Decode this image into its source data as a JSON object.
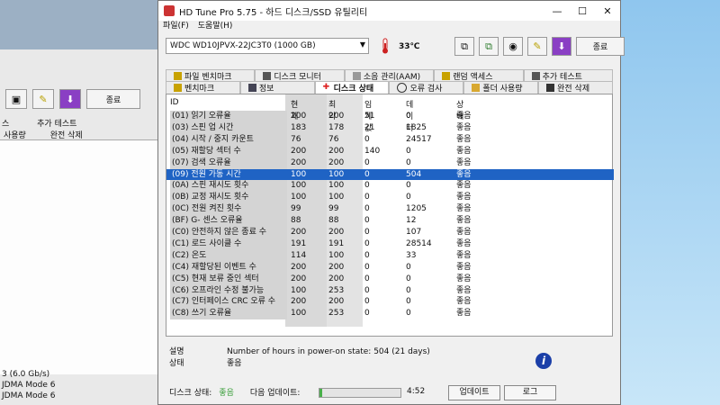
{
  "window": {
    "title": "HD Tune Pro 5.75 - 하드 디스크/SSD 유틸리티",
    "minimize": "—",
    "maximize": "☐",
    "close": "✕"
  },
  "menu": [
    "파일(F)",
    "도움말(H)"
  ],
  "toolbar": {
    "drive": "WDC WD10JPVX-22JC3T0 (1000 GB)",
    "temperature": "33℃",
    "exit_label": "종료"
  },
  "tabs_row1": [
    "파일 벤치마크",
    "디스크 모니터",
    "소음 관리(AAM)",
    "랜덤 액세스",
    "추가 테스트"
  ],
  "tabs_row2": [
    "벤치마크",
    "정보",
    "디스크 상태",
    "오류 검사",
    "폴더 사용량",
    "완전 삭제"
  ],
  "columns": [
    "ID",
    "현재",
    "최악",
    "임계값",
    "데이터",
    "상태"
  ],
  "rows": [
    {
      "id": "(01) 읽기 오류율",
      "cur": "200",
      "wor": "200",
      "thr": "51",
      "dat": "0",
      "st": "좋음"
    },
    {
      "id": "(03) 스핀 업 시간",
      "cur": "183",
      "wor": "178",
      "thr": "21",
      "dat": "1825",
      "st": "좋음"
    },
    {
      "id": "(04) 시작 / 중지 카운트",
      "cur": "76",
      "wor": "76",
      "thr": "0",
      "dat": "24517",
      "st": "좋음"
    },
    {
      "id": "(05) 재할당 섹터 수",
      "cur": "200",
      "wor": "200",
      "thr": "140",
      "dat": "0",
      "st": "좋음"
    },
    {
      "id": "(07) 검색 오류율",
      "cur": "200",
      "wor": "200",
      "thr": "0",
      "dat": "0",
      "st": "좋음"
    },
    {
      "id": "(09) 전원 가동 시간",
      "cur": "100",
      "wor": "100",
      "thr": "0",
      "dat": "504",
      "st": "좋음"
    },
    {
      "id": "(0A) 스핀 재시도 횟수",
      "cur": "100",
      "wor": "100",
      "thr": "0",
      "dat": "0",
      "st": "좋음"
    },
    {
      "id": "(0B) 교정 재시도 횟수",
      "cur": "100",
      "wor": "100",
      "thr": "0",
      "dat": "0",
      "st": "좋음"
    },
    {
      "id": "(0C) 전원 켜진 횟수",
      "cur": "99",
      "wor": "99",
      "thr": "0",
      "dat": "1205",
      "st": "좋음"
    },
    {
      "id": "(BF) G- 센스 오류율",
      "cur": "88",
      "wor": "88",
      "thr": "0",
      "dat": "12",
      "st": "좋음"
    },
    {
      "id": "(C0) 안전하지 않은 종료 수",
      "cur": "200",
      "wor": "200",
      "thr": "0",
      "dat": "107",
      "st": "좋음"
    },
    {
      "id": "(C1) 로드 사이클 수",
      "cur": "191",
      "wor": "191",
      "thr": "0",
      "dat": "28514",
      "st": "좋음"
    },
    {
      "id": "(C2) 온도",
      "cur": "114",
      "wor": "100",
      "thr": "0",
      "dat": "33",
      "st": "좋음"
    },
    {
      "id": "(C4) 재할당된 이벤트 수",
      "cur": "200",
      "wor": "200",
      "thr": "0",
      "dat": "0",
      "st": "좋음"
    },
    {
      "id": "(C5) 현재 보류 중인 섹터",
      "cur": "200",
      "wor": "200",
      "thr": "0",
      "dat": "0",
      "st": "좋음"
    },
    {
      "id": "(C6) 오프라인 수정 불가능",
      "cur": "100",
      "wor": "253",
      "thr": "0",
      "dat": "0",
      "st": "좋음"
    },
    {
      "id": "(C7) 인터페이스 CRC 오류 수",
      "cur": "200",
      "wor": "200",
      "thr": "0",
      "dat": "0",
      "st": "좋음"
    },
    {
      "id": "(C8) 쓰기 오류율",
      "cur": "100",
      "wor": "253",
      "thr": "0",
      "dat": "0",
      "st": "좋음"
    }
  ],
  "selected_row": 5,
  "info": {
    "desc_label": "설명",
    "desc_value": "Number of hours in power-on state: 504 (21 days)",
    "status_label": "상태",
    "status_value": "좋음"
  },
  "statusbar": {
    "disk_status_label": "디스크 상태:",
    "disk_status_value": "좋음",
    "next_update_label": "다음 업데이트:",
    "progress": 0.03,
    "time": "4:52",
    "update_button": "업데이트",
    "log_button": "로그"
  },
  "bg_window": {
    "exit_label": "종료",
    "tab_extra": "추가 테스트",
    "tab_usage": "사용량",
    "tab_wipe": "완전 삭제",
    "lines": [
      "3 (6.0 Gb/s)",
      "JDMA Mode 6",
      "JDMA Mode 6"
    ]
  },
  "colors": {
    "accent": "#1f63c4",
    "good_green": "#3a9e3a",
    "info_icon": "#1b3fa8"
  }
}
